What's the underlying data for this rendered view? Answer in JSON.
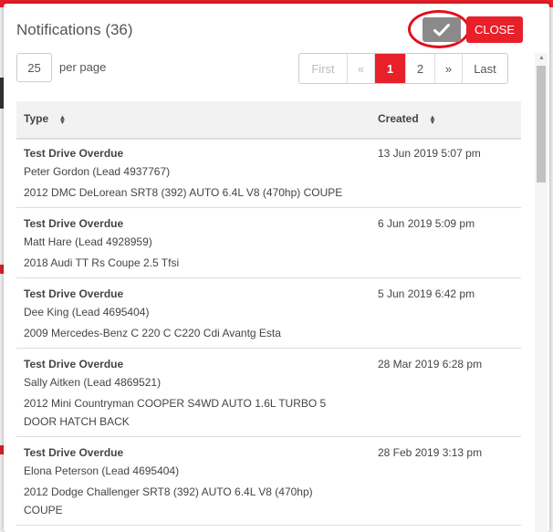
{
  "modal": {
    "title": "Notifications (36)",
    "confirm_icon": "checkmark-icon",
    "close_label": "CLOSE"
  },
  "per_page": {
    "value": "25",
    "label": "per page"
  },
  "pagination": {
    "first": "First",
    "prev": "«",
    "page1": "1",
    "page2": "2",
    "next": "»",
    "last": "Last",
    "current": 1
  },
  "table": {
    "headers": {
      "type": "Type",
      "created": "Created"
    },
    "rows": [
      {
        "type": "Test Drive Overdue",
        "lead": "Peter Gordon (Lead 4937767)",
        "vehicle": "2012 DMC DeLorean SRT8 (392) AUTO 6.4L V8 (470hp) COUPE",
        "created": "13 Jun 2019 5:07 pm"
      },
      {
        "type": "Test Drive Overdue",
        "lead": "Matt Hare (Lead 4928959)",
        "vehicle": "2018 Audi TT Rs Coupe 2.5 Tfsi",
        "created": "6 Jun 2019 5:09 pm"
      },
      {
        "type": "Test Drive Overdue",
        "lead": "Dee King (Lead 4695404)",
        "vehicle": "2009 Mercedes-Benz C 220 C C220 Cdi Avantg Esta",
        "created": "5 Jun 2019 6:42 pm"
      },
      {
        "type": "Test Drive Overdue",
        "lead": "Sally Aitken (Lead 4869521)",
        "vehicle": "2012 Mini Countryman COOPER S4WD AUTO 1.6L TURBO 5 DOOR HATCH BACK",
        "created": "28 Mar 2019 6:28 pm"
      },
      {
        "type": "Test Drive Overdue",
        "lead": "Elona Peterson (Lead 4695404)",
        "vehicle": "2012 Dodge Challenger SRT8 (392) AUTO 6.4L V8 (470hp) COUPE",
        "created": "28 Feb 2019 3:13 pm"
      }
    ]
  },
  "colors": {
    "accent": "#e8202a",
    "confirm_button": "#8a8a8a",
    "highlight_ring": "#e0101a"
  }
}
